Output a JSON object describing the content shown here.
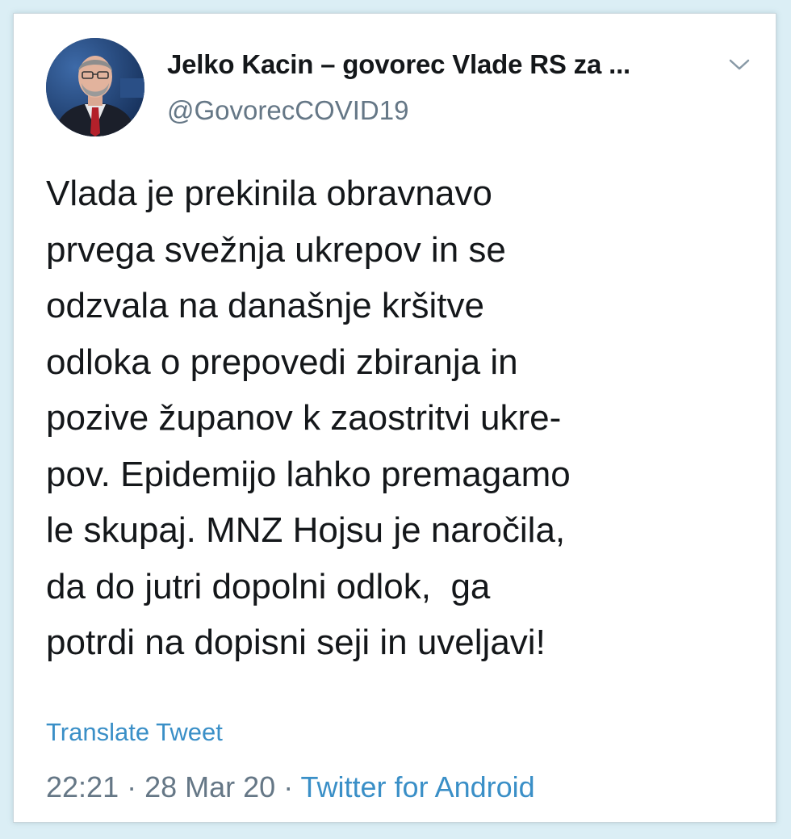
{
  "tweet": {
    "author": {
      "display_name": "Jelko Kacin – govorec Vlade RS za ...",
      "handle": "@GovorecCOVID19",
      "avatar_icon": "person-portrait"
    },
    "menu_icon": "chevron-down-icon",
    "text_lines": [
      "Vlada je prekinila obravnavo",
      "prvega svežnja ukrepov in se",
      "odzvala na današnje kršitve",
      "odloka o prepovedi zbiranja in",
      "pozive županov k zaostritvi ukre-",
      "pov. Epidemijo lahko premagamo",
      "le skupaj. MNZ Hojsu je naročila,",
      "da do jutri dopolni odlok,  ga",
      "potrdi na dopisni seji in uveljavi!"
    ],
    "translate_label": "Translate Tweet",
    "time": "22:21",
    "separator": " · ",
    "date": "28 Mar 20",
    "source": "Twitter for Android"
  },
  "colors": {
    "background": "#dbeef5",
    "text": "#14171a",
    "secondary": "#657786",
    "link": "#3a8fc7"
  }
}
